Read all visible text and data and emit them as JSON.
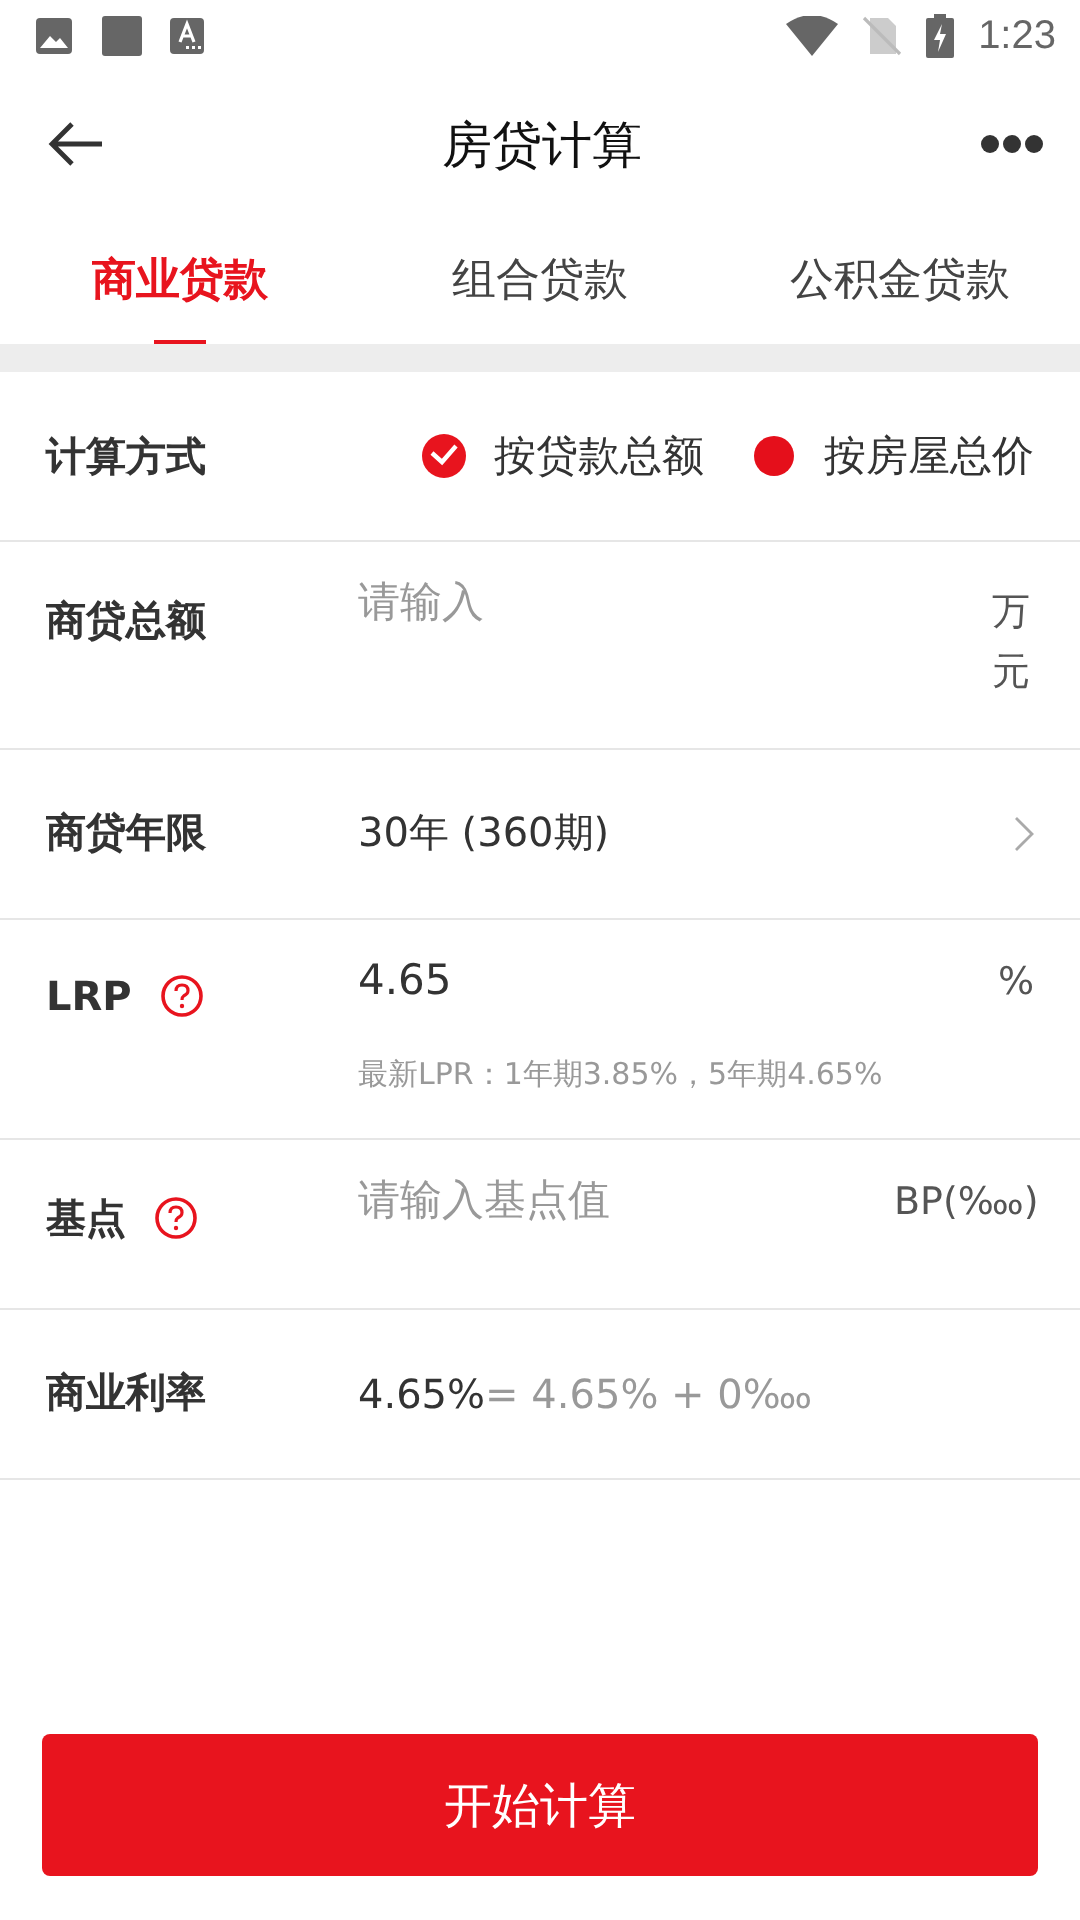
{
  "status_bar": {
    "time": "1:23"
  },
  "header": {
    "title": "房贷计算"
  },
  "tabs": [
    {
      "label": "商业贷款",
      "selected": true
    },
    {
      "label": "组合贷款",
      "selected": false
    },
    {
      "label": "公积金贷款",
      "selected": false
    }
  ],
  "rows": [
    {
      "kind": "radio",
      "label": "计算方式",
      "options": [
        {
          "label": "按贷款总额",
          "selected": true
        },
        {
          "label": "按房屋总价",
          "selected": false
        }
      ]
    },
    {
      "kind": "input",
      "label": "商贷总额",
      "placeholder": "请输入",
      "unit": "万元"
    },
    {
      "kind": "select",
      "label": "商贷年限",
      "value": "30年 (360期)"
    },
    {
      "kind": "input",
      "label": "LRP",
      "help": true,
      "value": "4.65",
      "unit": "%",
      "hint": "最新LPR：1年期3.85%，5年期4.65%"
    },
    {
      "kind": "input",
      "label": "基点",
      "help": true,
      "placeholder": "请输入基点值",
      "unit": "BP(‱)"
    },
    {
      "kind": "result",
      "label": "商业利率",
      "value": "4.65%",
      "formula": "= 4.65% + 0‱"
    }
  ],
  "submit": "开始计算"
}
